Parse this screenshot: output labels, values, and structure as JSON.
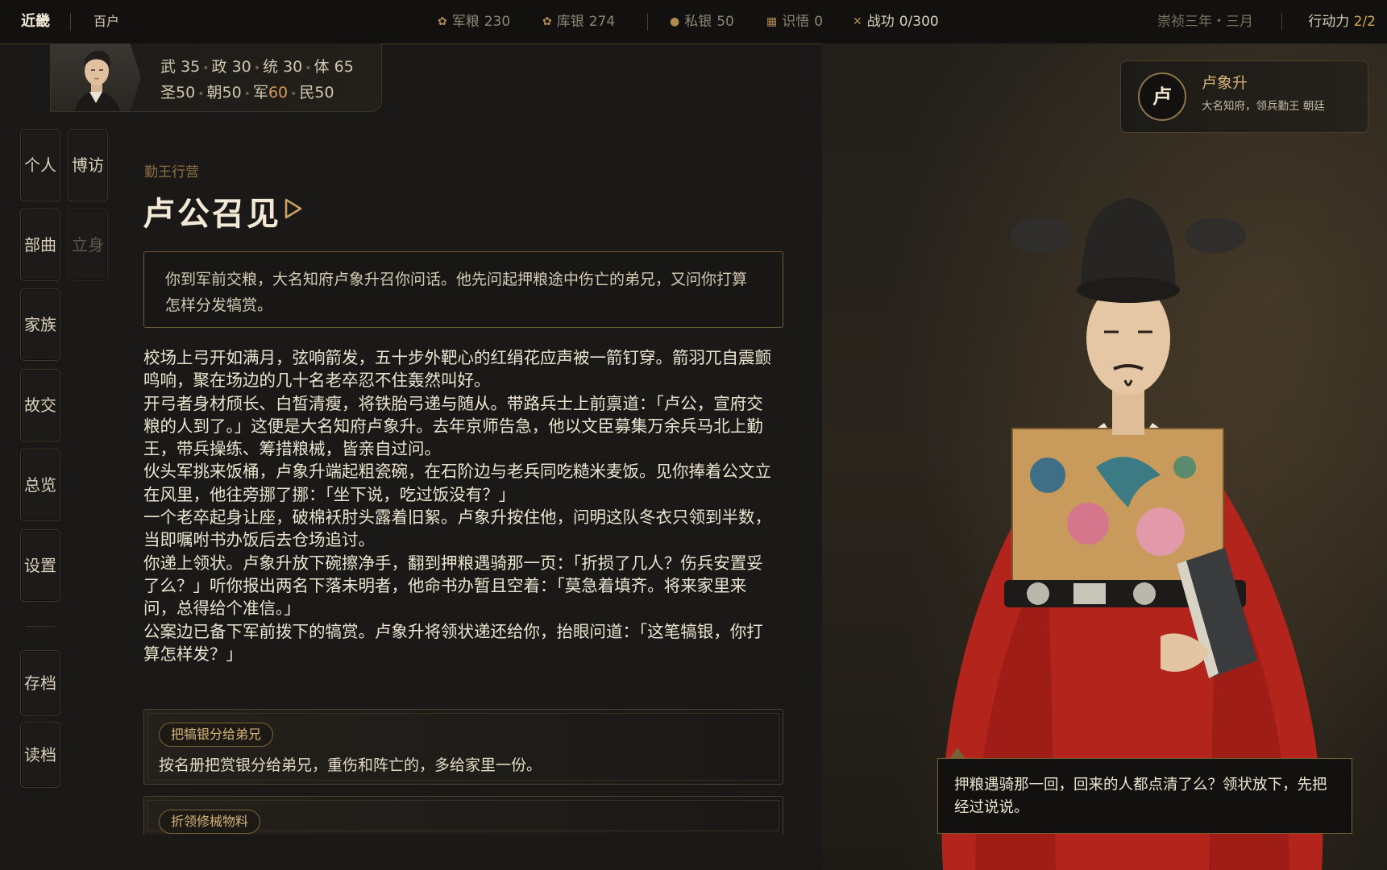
{
  "topbar": {
    "region": "近畿",
    "rank": "百户",
    "resources": [
      {
        "icon": "grain-icon",
        "glyph": "✿",
        "label": "军粮",
        "value": "230"
      },
      {
        "icon": "treasury-icon",
        "glyph": "✿",
        "label": "库银",
        "value": "274"
      }
    ],
    "personal": [
      {
        "icon": "money-bag-icon",
        "glyph": "●",
        "label": "私银",
        "value": "50"
      },
      {
        "icon": "insight-icon",
        "glyph": "▦",
        "label": "识悟",
        "value": "0"
      }
    ],
    "merit": {
      "icon": "crossed-swords-icon",
      "glyph": "✕",
      "label": "战功",
      "value": "0/300"
    },
    "date": "崇祯三年・三月",
    "action_points_label": "行动力",
    "action_points_value": "2/2"
  },
  "player": {
    "stats_row1": [
      {
        "label": "武",
        "value": "35"
      },
      {
        "label": "政",
        "value": "30"
      },
      {
        "label": "统",
        "value": "30"
      },
      {
        "label": "体",
        "value": "65"
      }
    ],
    "stats_row2": [
      {
        "label": "圣",
        "value": "50"
      },
      {
        "label": "朝",
        "value": "50"
      },
      {
        "label": "军",
        "value": "60"
      },
      {
        "label": "民",
        "value": "50"
      }
    ]
  },
  "nav": {
    "personal": "个人",
    "visit": "博访",
    "troops": "部曲",
    "establish": "立身",
    "family": "家族",
    "friends": "故交",
    "overview": "总览",
    "settings": "设置",
    "save": "存档",
    "load": "读档"
  },
  "scene": {
    "section": "勤王行营",
    "title": "卢公召见",
    "intro": "你到军前交粮，大名知府卢象升召你问话。他先问起押粮途中伤亡的弟兄，又问你打算怎样分发犒赏。",
    "paragraphs": [
      "校场上弓开如满月，弦响箭发，五十步外靶心的红绢花应声被一箭钉穿。箭羽兀自震颤鸣响，聚在场边的几十名老卒忍不住轰然叫好。",
      "开弓者身材颀长、白皙清瘦，将铁胎弓递与随从。带路兵士上前禀道：「卢公，宣府交粮的人到了。」这便是大名知府卢象升。去年京师告急，他以文臣募集万余兵马北上勤王，带兵操练、筹措粮械，皆亲自过问。",
      "伙头军挑来饭桶，卢象升端起粗瓷碗，在石阶边与老兵同吃糙米麦饭。见你捧着公文立在风里，他往旁挪了挪：「坐下说，吃过饭没有？」",
      "一个老卒起身让座，破棉袄肘头露着旧絮。卢象升按住他，问明这队冬衣只领到半数，当即嘱咐书办饭后去仓场追讨。",
      "你递上领状。卢象升放下碗擦净手，翻到押粮遇骑那一页：「折损了几人？伤兵安置妥了么？」听你报出两名下落未明者，他命书办暂且空着：「莫急着填齐。将来家里来问，总得给个准信。」",
      "公案边已备下军前拨下的犒赏。卢象升将领状递还给你，抬眼问道：「这笔犒银，你打算怎样发？」"
    ]
  },
  "choices": [
    {
      "tag": "把犒银分给弟兄",
      "desc": "按名册把赏银分给弟兄，重伤和阵亡的，多给家里一份。"
    },
    {
      "tag": "折领修械物料",
      "desc": ""
    }
  ],
  "npc": {
    "avatar_char": "卢",
    "name": "卢象升",
    "desc": "大名知府，领兵勤王 朝廷"
  },
  "dialogue": "押粮遇骑那一回，回来的人都点清了么？领状放下，先把经过说说。",
  "colors": {
    "accent_gold": "#d6b477",
    "robe_red": "#b3241c",
    "background": "#1a1917"
  }
}
